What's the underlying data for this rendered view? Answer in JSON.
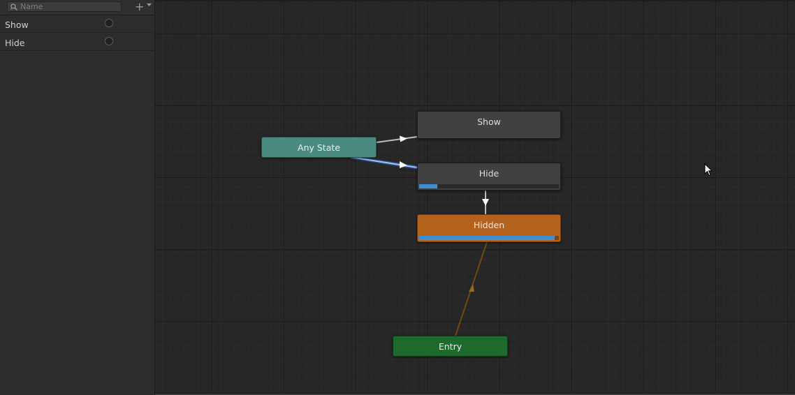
{
  "parameters_panel": {
    "search": {
      "placeholder": "Name",
      "value": ""
    },
    "add_icon": "plus-icon",
    "items": [
      {
        "label": "Show",
        "type": "trigger",
        "set": false
      },
      {
        "label": "Hide",
        "type": "trigger",
        "set": false
      }
    ]
  },
  "graph": {
    "nodes": {
      "show": {
        "label": "Show",
        "color": "#414141"
      },
      "hide": {
        "label": "Hide",
        "color": "#414141",
        "progress": 0.13
      },
      "hidden": {
        "label": "Hidden",
        "color": "#b7621c",
        "is_default": true,
        "progress": 0.97
      },
      "any_state": {
        "label": "Any State",
        "color": "#4b8a7e"
      },
      "entry": {
        "label": "Entry",
        "color": "#1d6a2c"
      }
    },
    "transitions": [
      {
        "from": "Any State",
        "to": "Show",
        "active": false
      },
      {
        "from": "Any State",
        "to": "Hide",
        "active": true
      },
      {
        "from": "Hide",
        "to": "Hidden",
        "active": false
      },
      {
        "from": "Entry",
        "to": "Hidden",
        "default": true
      }
    ],
    "colors": {
      "active_transition": "#5b9bff",
      "transition": "#bdbdbd",
      "default_transition": "#6b4a13",
      "progress": "#3f8fd6"
    }
  }
}
